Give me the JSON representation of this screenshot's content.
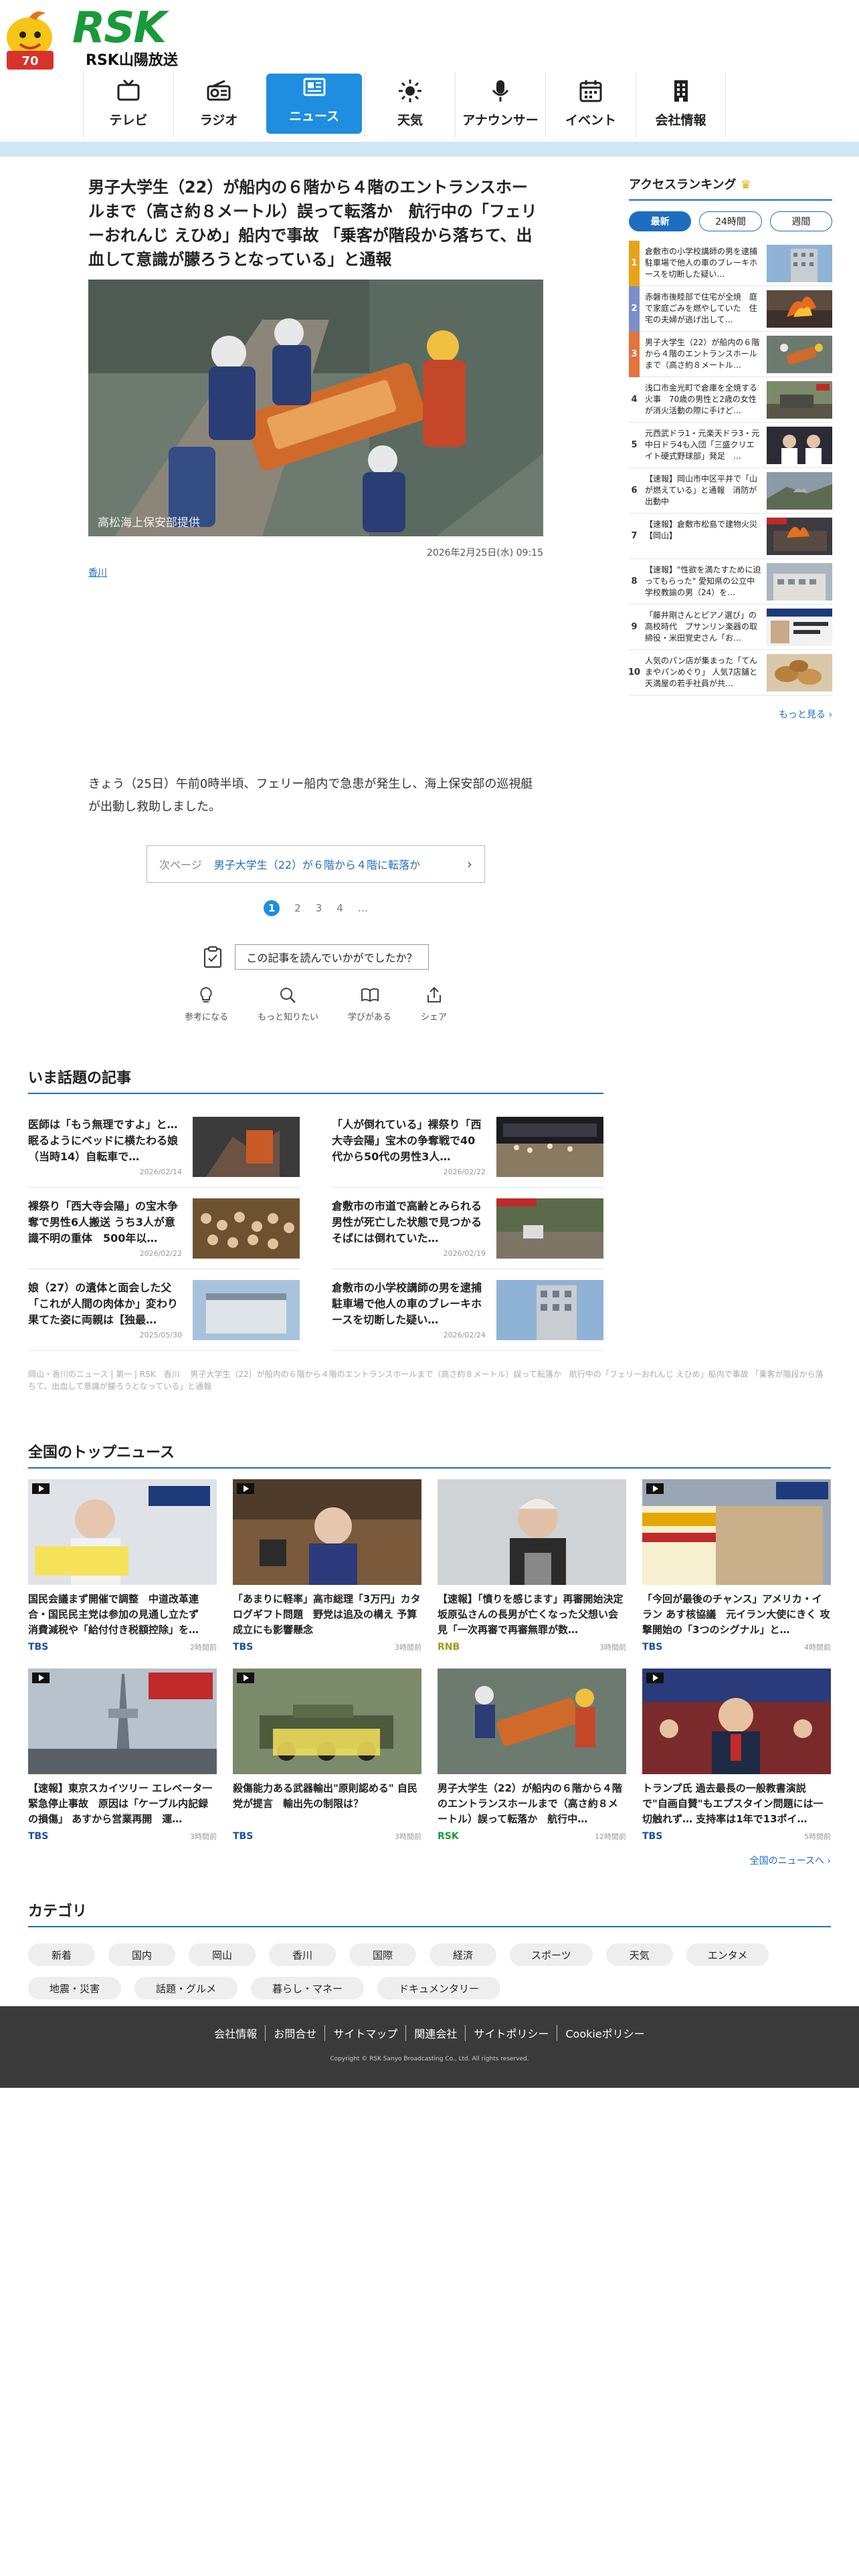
{
  "header": {
    "brand": "RSK",
    "brand_sub": "RSK山陽放送",
    "nav": [
      {
        "label": "テレビ",
        "icon": "tv-icon"
      },
      {
        "label": "ラジオ",
        "icon": "radio-icon"
      },
      {
        "label": "ニュース",
        "icon": "news-icon",
        "active": true
      },
      {
        "label": "天気",
        "icon": "sun-icon"
      },
      {
        "label": "アナウンサー",
        "icon": "microphone-icon"
      },
      {
        "label": "イベント",
        "icon": "calendar-icon"
      },
      {
        "label": "会社情報",
        "icon": "building-icon"
      }
    ]
  },
  "article": {
    "headline": "男子大学生（22）が船内の６階から４階のエントランスホールまで（高さ約８メートル）誤って転落か　航行中の「フェリーおれんじ えひめ」船内で事故 「乗客が階段から落ちて、出血して意識が朦ろうとなっている」と通報",
    "photo_caption": "高松海上保安部提供",
    "date": "2026年2月25日(水) 09:15",
    "tag": "香川",
    "body": "きょう（25日）午前0時半頃、フェリー船内で急患が発生し、海上保安部の巡視艇が出動し救助しました。",
    "next_label": "次ページ",
    "next_title": "男子大学生（22）が６階から４階に転落か",
    "pages": [
      "1",
      "2",
      "3",
      "4",
      "…"
    ],
    "feedback_question": "この記事を読んでいかがでしたか？",
    "reactions": [
      {
        "label": "参考になる",
        "icon": "lightbulb-icon"
      },
      {
        "label": "もっと知りたい",
        "icon": "magnifier-icon"
      },
      {
        "label": "学びがある",
        "icon": "book-icon"
      },
      {
        "label": "シェア",
        "icon": "share-icon"
      }
    ]
  },
  "ranking": {
    "title": "アクセスランキング",
    "tabs": [
      "最新",
      "24時間",
      "週間"
    ],
    "items": [
      {
        "rank": "1",
        "text": "倉敷市の小学校講師の男を逮捕 駐車場で他人の車のブレーキホースを切断した疑い…"
      },
      {
        "rank": "2",
        "text": "赤磐市後睦部で住宅が全焼　庭で家庭ごみを燃やしていた　住宅の夫婦が逃げ出して…"
      },
      {
        "rank": "3",
        "text": "男子大学生（22）が船内の６階から４階のエントランスホールまで（高さ約８メートル…"
      },
      {
        "rank": "4",
        "text": "浅口市金光町で倉庫を全焼する火事　70歳の男性と2歳の女性が消火活動の際に手けど…"
      },
      {
        "rank": "5",
        "text": "元西武ドラ1・元楽天ドラ3・元中日ドラ4も入団「三盛クリエイト硬式野球部」発足　…"
      },
      {
        "rank": "6",
        "text": "【速報】岡山市中区平井で「山が燃えている」と通報　消防が出動中"
      },
      {
        "rank": "7",
        "text": "【速報】倉敷市松島で建物火災【岡山】"
      },
      {
        "rank": "8",
        "text": "【速報】\"性欲を満たすために迫ってもらった\" 愛知県の公立中学校教諭の男（24）を…"
      },
      {
        "rank": "9",
        "text": "「藤井剛さんとピアノ選び」の高校時代　プサンリン楽器の取締役・米田覚史さん「お…"
      },
      {
        "rank": "10",
        "text": "人気のパン店が集まった「てんまやパンめぐり」 人気7店舗と天満屋の若手社員が共…"
      }
    ],
    "more": "もっと見る"
  },
  "topics": {
    "title": "いま話題の記事",
    "items": [
      {
        "title": "医師は「もう無理ですよ」と…眠るようにベッドに横たわる娘（当時14）自転車で…",
        "date": "2026/02/14"
      },
      {
        "title": "「人が倒れている」裸祭り「西大寺会陽」宝木の争奪戦で40代から50代の男性3人…",
        "date": "2026/02/22"
      },
      {
        "title": "裸祭り「西大寺会陽」の宝木争奪で男性6人搬送 うち3人が意識不明の重体　500年以…",
        "date": "2026/02/22"
      },
      {
        "title": "倉敷市の市道で高齢とみられる男性が死亡した状態で見つかる　そばには倒れていた…",
        "date": "2026/02/19"
      },
      {
        "title": "娘（27）の遺体と面会した父「これが人間の肉体か」変わり果てた姿に両親は【独最…",
        "date": "2025/05/30"
      },
      {
        "title": "倉敷市の小学校講師の男を逮捕　駐車場で他人の車のブレーキホースを切断した疑い…",
        "date": "2026/02/24"
      }
    ],
    "breadcrumb": "岡山・香川のニュース | 第一 | RSK　香川 　男子大学生（22）が船内の６階から４階のエントランスホールまで（高さ約８メートル）誤って転落か　航行中の「フェリーおれんじ えひめ」船内で事故 「乗客が階段から落ちて、出血して意識が朦ろうとなっている」と通報"
  },
  "top_news": {
    "title": "全国のトップニュース",
    "items": [
      {
        "title": "国民会議まず開催で調整　中道改革連合・国民民主党は参加の見通し立たず　消費減税や「給付付き税額控除」を…",
        "src": "TBS",
        "time": "2時間前"
      },
      {
        "title": "「あまりに軽率」高市総理「3万円」カタログギフト問題　野党は追及の構え 予算成立にも影響懸念",
        "src": "TBS",
        "time": "3時間前"
      },
      {
        "title": "【速報】「憤りを感じます」再審開始決定　坂原弘さんの長男が亡くなった父想い会見「一次再審で再審無罪が数…",
        "src": "RNB",
        "time": "3時間前"
      },
      {
        "title": "「今回が最後のチャンス」アメリカ・イラン あす核協議　元イラン大使にきく 攻撃開始の「3つのシグナル」と…",
        "src": "TBS",
        "time": "4時間前"
      },
      {
        "title": "【速報】東京スカイツリー エレベータ一緊急停止事故　原因は「ケーブル内記録の損傷」 あすから営業再開　運…",
        "src": "TBS",
        "time": "3時間前"
      },
      {
        "title": "殺傷能力ある武器輸出\"原則認める\" 自民党が提言　輸出先の制限は？",
        "src": "TBS",
        "time": "3時間前"
      },
      {
        "title": "男子大学生（22）が船内の６階から４階のエントランスホールまで（高さ約８メートル）誤って転落か　航行中…",
        "src": "RSK",
        "time": "12時間前"
      },
      {
        "title": "トランプ氏 過去最長の一般教書演説で\"自画自賛\"もエプスタイン問題には一切触れず… 支持率は1年で13ポイ…",
        "src": "TBS",
        "time": "5時間前"
      }
    ],
    "all_link": "全国のニュースへ"
  },
  "categories": {
    "title": "カテゴリ",
    "items": [
      "新着",
      "国内",
      "岡山",
      "香川",
      "国際",
      "経済",
      "スポーツ",
      "天気",
      "エンタメ",
      "地震・災害",
      "話題・グルメ",
      "暮らし・マネー",
      "ドキュメンタリー"
    ]
  },
  "footer": {
    "links": [
      "会社情報",
      "お問合せ",
      "サイトマップ",
      "関連会社",
      "サイトポリシー",
      "Cookieポリシー"
    ],
    "copyright": "Copyright © RSK Sanyo Broadcasting Co., Ltd. All rights reserved."
  },
  "colors": {
    "accent": "#1f8de0",
    "link": "#1f6dbf",
    "brand_green": "#1a9a3a",
    "footer_bg": "#3a3a3a",
    "subbar": "#cfe6f4"
  }
}
